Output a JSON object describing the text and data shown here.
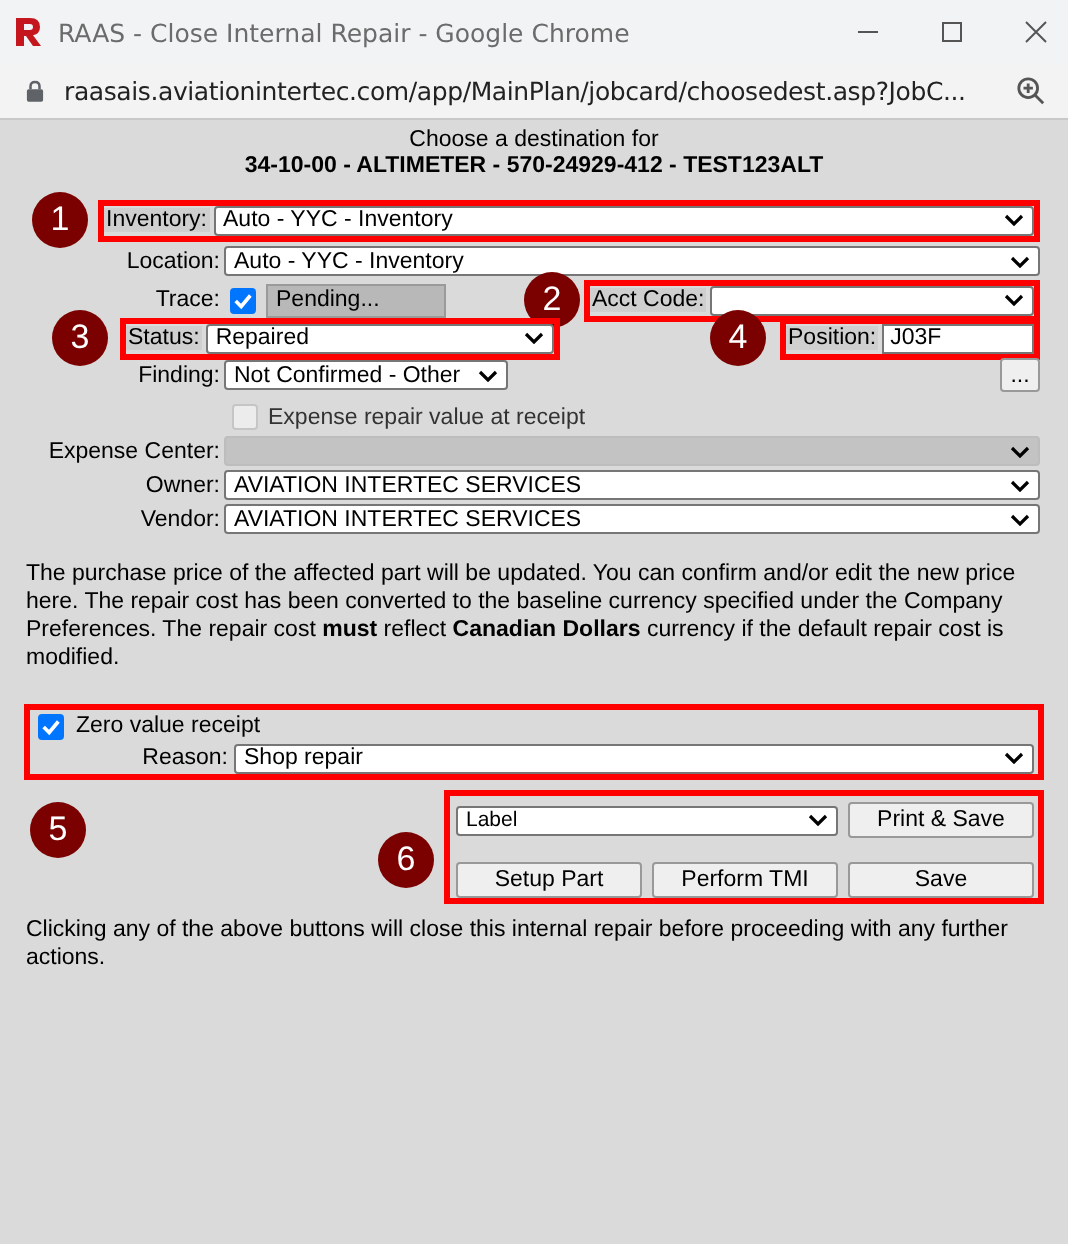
{
  "window": {
    "title": "RAAS - Close Internal Repair - Google Chrome",
    "url": "raasais.aviationintertec.com/app/MainPlan/jobcard/choosedest.asp?JobC..."
  },
  "heading": {
    "line1": "Choose a destination for",
    "line2": "34-10-00 - ALTIMETER - 570-24929-412 - TEST123ALT"
  },
  "fields": {
    "inventory": {
      "label": "Inventory:",
      "value": "Auto - YYC - Inventory",
      "highlighted": true,
      "callout": "1"
    },
    "location": {
      "label": "Location:",
      "value": "Auto - YYC - Inventory"
    },
    "trace": {
      "label": "Trace:",
      "checked": true,
      "value": "Pending..."
    },
    "acct_code": {
      "label": "Acct Code:",
      "highlighted": true,
      "callout": "2"
    },
    "status": {
      "label": "Status:",
      "value": "Repaired",
      "highlighted": true,
      "callout": "3"
    },
    "position": {
      "label": "Position:",
      "value": "J03F",
      "highlighted": true,
      "callout": "4"
    },
    "finding": {
      "label": "Finding:",
      "value": "Not Confirmed - Other"
    },
    "finding_button": "...",
    "expense_repair": {
      "label": "Expense repair value at receipt",
      "checked": false,
      "disabled": true
    },
    "expense_center": {
      "label": "Expense Center:",
      "disabled": true
    },
    "owner": {
      "label": "Owner:",
      "value": "AVIATION INTERTEC SERVICES"
    },
    "vendor": {
      "label": "Vendor:",
      "value": "AVIATION INTERTEC SERVICES"
    }
  },
  "notice": "The purchase price of the affected part will be updated. You can confirm and/or edit the new price here. The repair cost has been converted to the baseline currency specified under the Company Preferences. The repair cost **must** reflect **Canadian Dollars** currency if the default repair cost is modified.",
  "zero_value": {
    "label": "Zero value receipt",
    "checked": true,
    "highlighted": true,
    "callout": "5",
    "reason": {
      "label": "Reason:",
      "value": "Shop repair"
    }
  },
  "actions": {
    "highlighted": true,
    "callout": "6",
    "print_format": "Label",
    "buttons": [
      "Print & Save",
      "Setup Part",
      "Perform TMI",
      "Save"
    ]
  },
  "footer": "Clicking any of the above buttons will close this internal repair before proceeding with any further actions."
}
